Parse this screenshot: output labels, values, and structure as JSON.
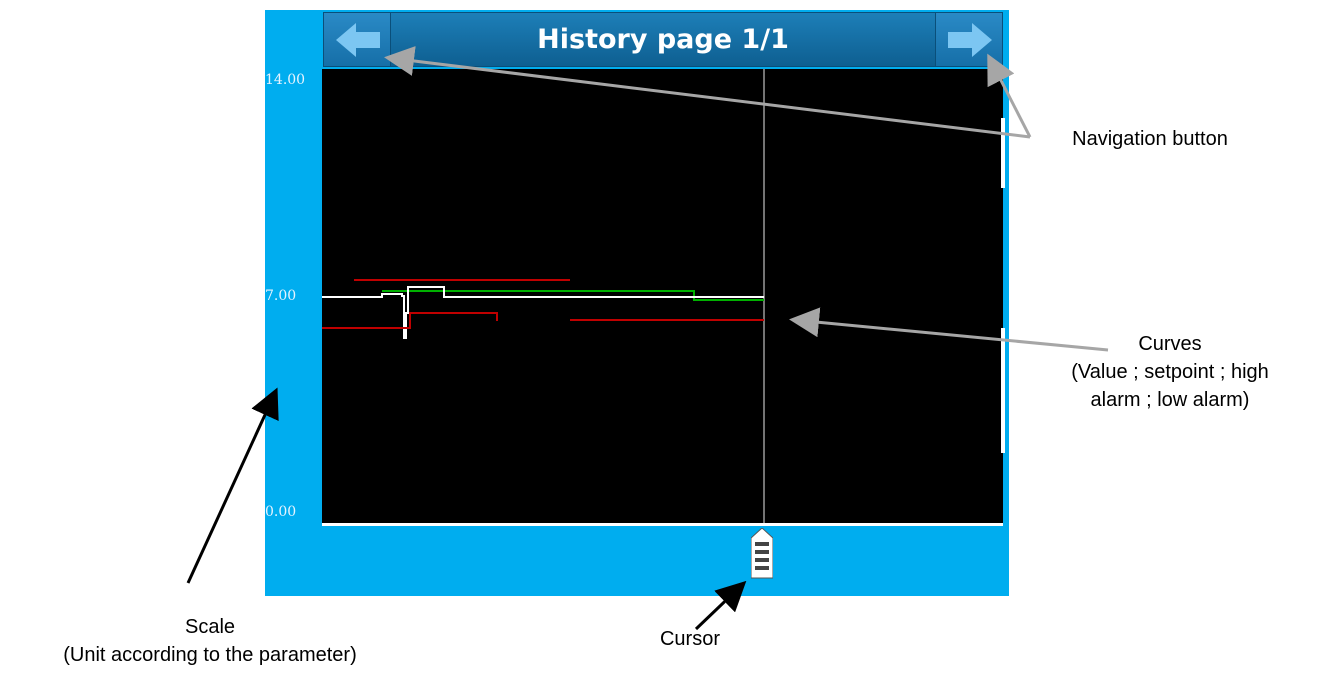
{
  "window": {
    "title": "History page 1/1",
    "nav_left_icon": "arrow-left-icon",
    "nav_right_icon": "arrow-right-icon"
  },
  "scale": {
    "ticks": [
      "14.00",
      "7.00",
      "0.00"
    ],
    "ymin": 0,
    "ymax": 14
  },
  "cursor": {
    "icon": "cursor-handle-icon"
  },
  "annotations": {
    "navigation": "Navigation button",
    "curves_line1": "Curves",
    "curves_line2": "(Value ; setpoint ; high",
    "curves_line3": "alarm ; low alarm)",
    "scale_line1": "Scale",
    "scale_line2": "(Unit according to the parameter)",
    "cursor": "Cursor"
  },
  "colors": {
    "background": "#00adef",
    "plot": "#000000",
    "value_curve": "#ffffff",
    "setpoint_curve": "#00b000",
    "alarm_curve": "#c00000"
  }
}
